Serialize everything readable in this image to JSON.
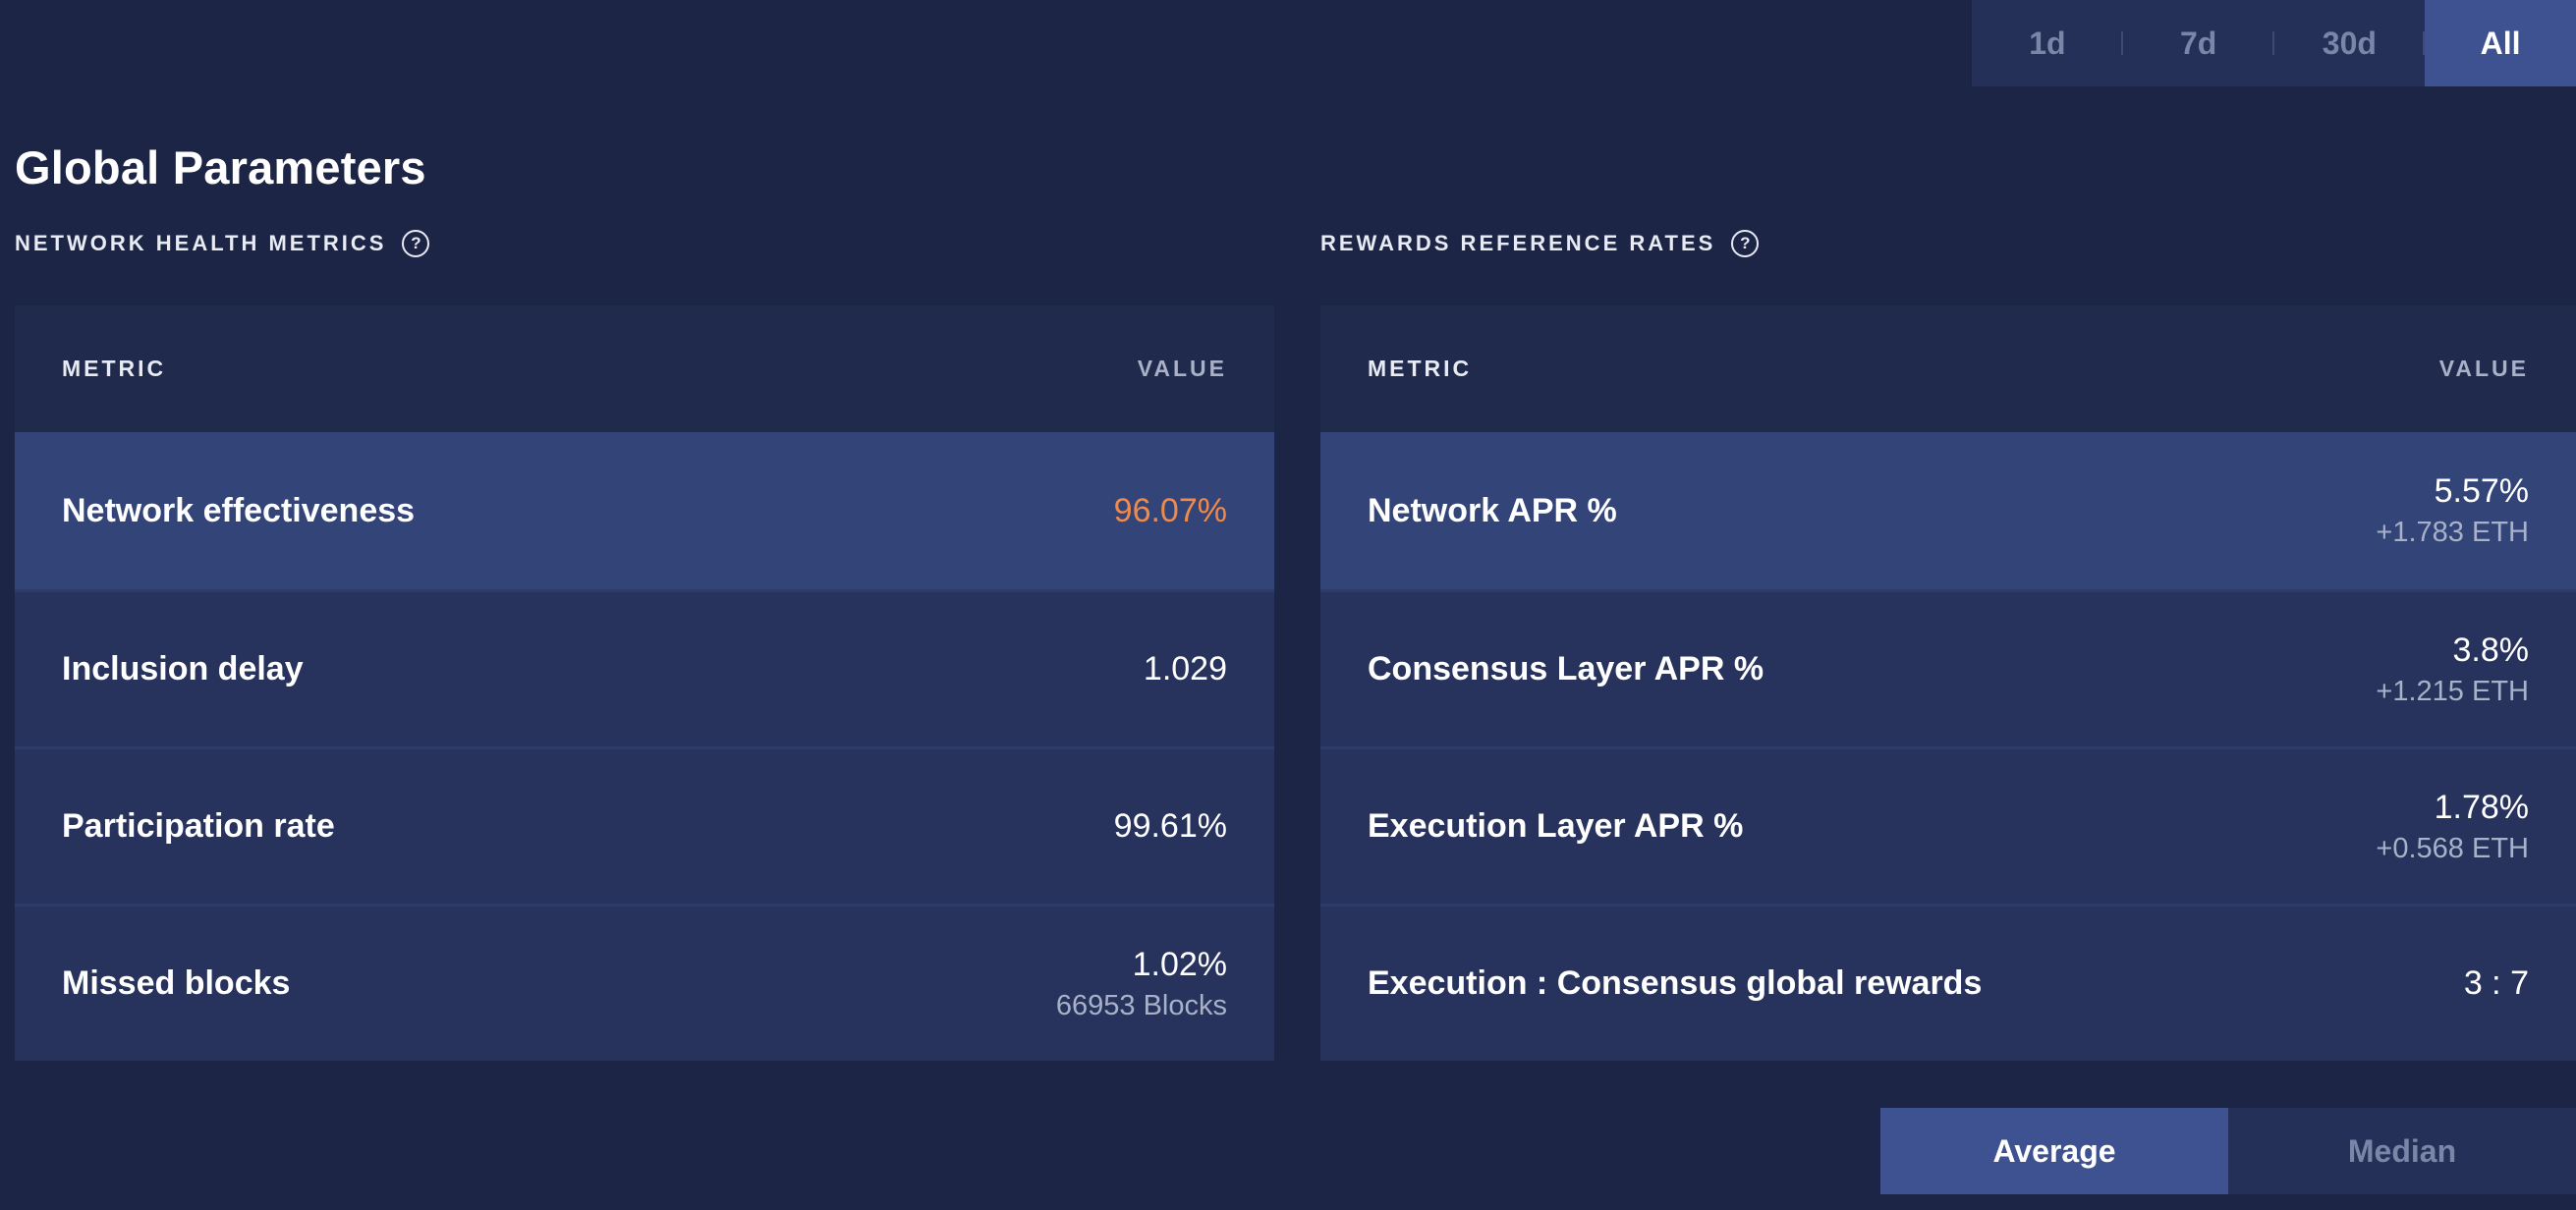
{
  "range": {
    "options": [
      "1d",
      "7d",
      "30d",
      "All"
    ],
    "selected": "All"
  },
  "title": "Global Parameters",
  "network_health": {
    "label": "NETWORK HEALTH METRICS",
    "header_metric": "METRIC",
    "header_value": "VALUE",
    "rows": [
      {
        "label": "Network effectiveness",
        "value": "96.07%",
        "sub": ""
      },
      {
        "label": "Inclusion delay",
        "value": "1.029",
        "sub": ""
      },
      {
        "label": "Participation rate",
        "value": "99.61%",
        "sub": ""
      },
      {
        "label": "Missed blocks",
        "value": "1.02%",
        "sub": "66953 Blocks"
      }
    ]
  },
  "rewards": {
    "label": "REWARDS REFERENCE RATES",
    "header_metric": "METRIC",
    "header_value": "VALUE",
    "rows": [
      {
        "label": "Network APR %",
        "value": "5.57%",
        "sub": "+1.783 ETH"
      },
      {
        "label": "Consensus Layer APR %",
        "value": "3.8%",
        "sub": "+1.215 ETH"
      },
      {
        "label": "Execution Layer APR %",
        "value": "1.78%",
        "sub": "+0.568 ETH"
      },
      {
        "label": "Execution : Consensus global rewards",
        "value": "3 : 7",
        "sub": ""
      }
    ]
  },
  "aggregation": {
    "options": [
      "Average",
      "Median"
    ],
    "selected": "Average"
  },
  "colors": {
    "background": "#1c2545",
    "accent": "#3e5191",
    "highlight_value": "#ef8a4b"
  },
  "icons": {
    "help": "question-circle-icon"
  }
}
